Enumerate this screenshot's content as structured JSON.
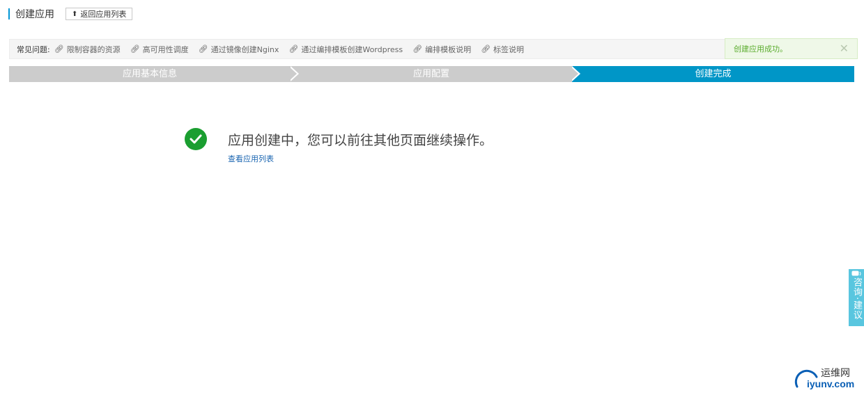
{
  "header": {
    "title": "创建应用",
    "back_button_label": "返回应用列表"
  },
  "faq": {
    "label": "常见问题:",
    "links": [
      "限制容器的资源",
      "高可用性调度",
      "通过镜像创建Nginx",
      "通过编排模板创建Wordpress",
      "编排模板说明",
      "标签说明"
    ]
  },
  "toast": {
    "message": "创建应用成功。",
    "close_symbol": "✕"
  },
  "steps": [
    {
      "label": "应用基本信息",
      "state": "done"
    },
    {
      "label": "应用配置",
      "state": "done"
    },
    {
      "label": "创建完成",
      "state": "active"
    }
  ],
  "result": {
    "message": "应用创建中，您可以前往其他页面继续操作。",
    "link_label": "查看应用列表"
  },
  "feedback": {
    "label": "咨询·建议"
  },
  "watermark": {
    "cn": "运维网",
    "en": "iyunv.com"
  },
  "colors": {
    "accent": "#0096c7",
    "step_done": "#cccccc",
    "success": "#1a9e30",
    "toast_text": "#5cad2f",
    "link": "#1b66b1"
  }
}
